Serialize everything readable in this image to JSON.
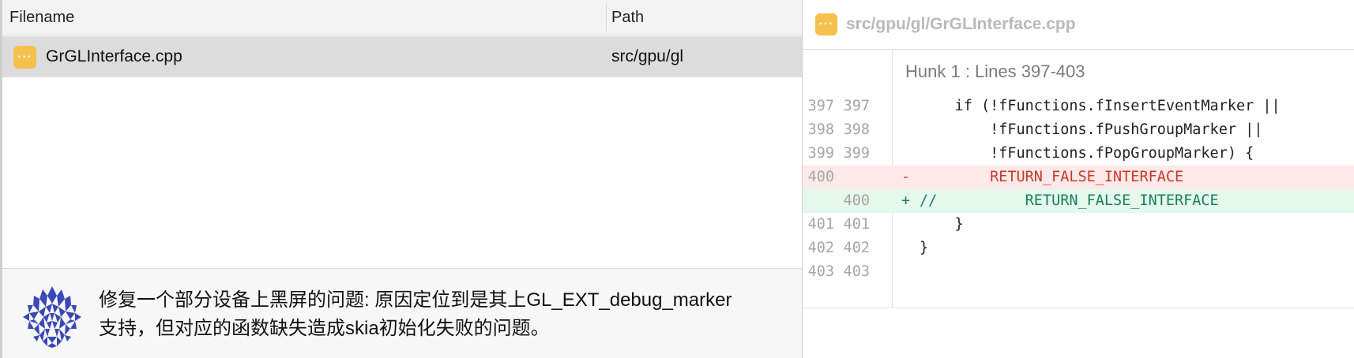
{
  "file_list": {
    "columns": [
      "Filename",
      "Path"
    ],
    "rows": [
      {
        "icon": "cpp-file-icon",
        "filename": "GrGLInterface.cpp",
        "path": "src/gpu/gl"
      }
    ]
  },
  "commit": {
    "message_line1": "修复一个部分设备上黑屏的问题: 原因定位到是其上GL_EXT_debug_marker",
    "message_line2": "支持，但对应的函数缺失造成skia初始化失败的问题。"
  },
  "diff": {
    "file_path": "src/gpu/gl/GrGLInterface.cpp",
    "hunk_header": "Hunk 1 : Lines 397-403",
    "lines": [
      {
        "old": "397",
        "new": "397",
        "type": "context",
        "sign": "",
        "text": "    if (!fFunctions.fInsertEventMarker ||"
      },
      {
        "old": "398",
        "new": "398",
        "type": "context",
        "sign": "",
        "text": "        !fFunctions.fPushGroupMarker ||"
      },
      {
        "old": "399",
        "new": "399",
        "type": "context",
        "sign": "",
        "text": "        !fFunctions.fPopGroupMarker) {"
      },
      {
        "old": "400",
        "new": "",
        "type": "del",
        "sign": "-",
        "text": "        RETURN_FALSE_INTERFACE"
      },
      {
        "old": "",
        "new": "400",
        "type": "add",
        "sign": "+",
        "text": "//          RETURN_FALSE_INTERFACE"
      },
      {
        "old": "401",
        "new": "401",
        "type": "context",
        "sign": "",
        "text": "    }"
      },
      {
        "old": "402",
        "new": "402",
        "type": "context",
        "sign": "",
        "text": "}"
      },
      {
        "old": "403",
        "new": "403",
        "type": "context",
        "sign": "",
        "text": ""
      }
    ]
  },
  "colors": {
    "file_icon": "#f5c04c",
    "selected_row": "#dcdcdc",
    "deleted_bg": "#fde9e9",
    "added_bg": "#e4f8ec",
    "deleted_text": "#c83a28",
    "added_text": "#1b7e5a",
    "avatar": "#3a47b5"
  }
}
